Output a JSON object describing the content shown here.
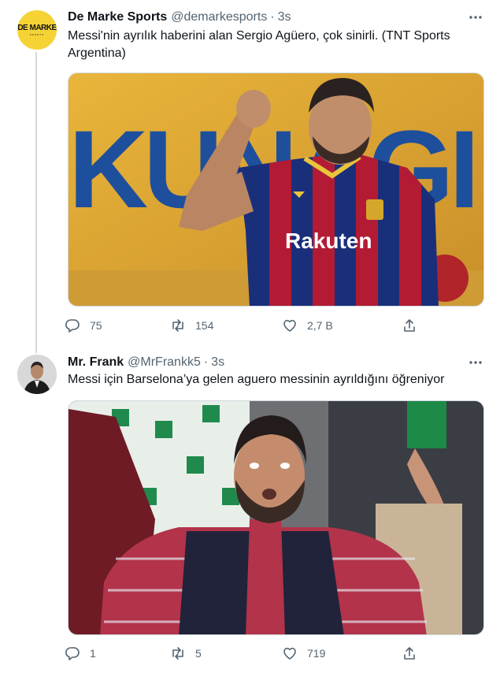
{
  "tweets": [
    {
      "avatar_text": "DE MARKE",
      "avatar_subtext": "SPORTS",
      "name": "De Marke Sports",
      "handle": "@demarkesports",
      "separator": "·",
      "time": "3s",
      "text": "Messi'nin ayrılık haberini alan Sergio Agüero, çok sinirli. (TNT Sports Argentina)",
      "media": {
        "banner_text": "KUNAGI",
        "sponsor_text": "Rakuten"
      },
      "counts": {
        "replies": "75",
        "retweets": "154",
        "likes": "2,7 B"
      }
    },
    {
      "name": "Mr. Frank",
      "handle": "@MrFrankk5",
      "separator": "·",
      "time": "3s",
      "text": "Messi için Barselona’ya gelen aguero messinin ayrıldığını öğreniyor",
      "counts": {
        "replies": "1",
        "retweets": "5",
        "likes": "719"
      }
    }
  ],
  "icons": {
    "more": "more-horizontal-icon",
    "reply": "reply-icon",
    "retweet": "retweet-icon",
    "like": "heart-icon",
    "share": "share-icon"
  },
  "colors": {
    "text_primary": "#0f1419",
    "text_secondary": "#536471",
    "border": "#cfd9de",
    "avatar_yellow": "#f5d335"
  }
}
